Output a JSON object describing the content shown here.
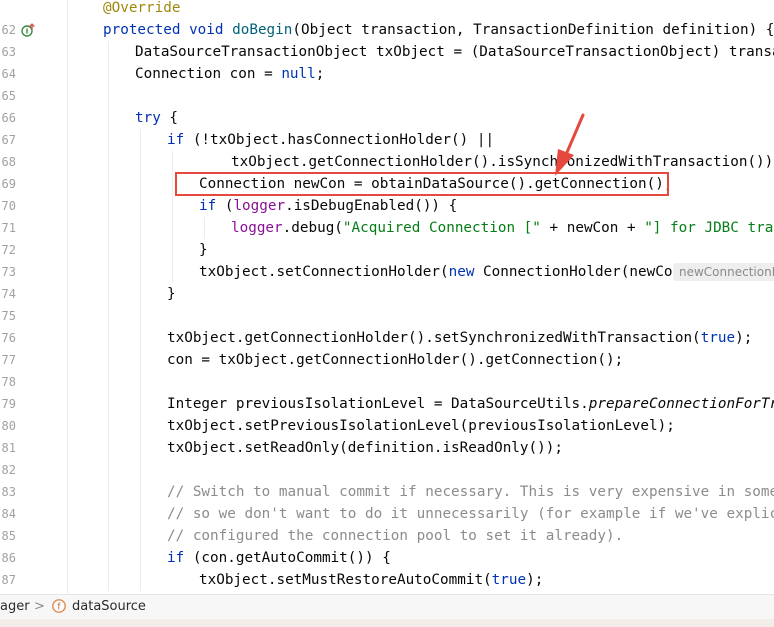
{
  "editor": {
    "lines": [
      {
        "num": "",
        "tokens": [
          {
            "t": "@Override",
            "c": "ann"
          }
        ]
      },
      {
        "num": "62",
        "gutter_icon": "override-implements-icon",
        "tokens": [
          {
            "t": "protected void ",
            "c": "kw"
          },
          {
            "t": "doBegin",
            "c": "fn"
          },
          {
            "t": "(Object transaction, TransactionDefinition definition) {",
            "c": ""
          }
        ]
      },
      {
        "num": "63",
        "tokens": [
          {
            "t": "DataSourceTransactionObject txObject = (DataSourceTransactionObject) transaction",
            "c": ""
          }
        ]
      },
      {
        "num": "64",
        "tokens": [
          {
            "t": "Connection con = ",
            "c": ""
          },
          {
            "t": "null",
            "c": "kw"
          },
          {
            "t": ";",
            "c": ""
          }
        ]
      },
      {
        "num": "65",
        "tokens": []
      },
      {
        "num": "66",
        "tokens": [
          {
            "t": "try",
            "c": "kw"
          },
          {
            "t": " {",
            "c": ""
          }
        ]
      },
      {
        "num": "67",
        "tokens": [
          {
            "t": "if",
            "c": "kw"
          },
          {
            "t": " (!txObject.hasConnectionHolder() ||",
            "c": ""
          }
        ]
      },
      {
        "num": "68",
        "tokens": [
          {
            "t": "txObject.getConnectionHolder().isSynchronizedWithTransaction()) {",
            "c": ""
          }
        ]
      },
      {
        "num": "69",
        "tokens": [
          {
            "t": "Connection newCon = obtainDataSource().getConnection();",
            "c": ""
          }
        ]
      },
      {
        "num": "70",
        "tokens": [
          {
            "t": "if",
            "c": "kw"
          },
          {
            "t": " (",
            "c": ""
          },
          {
            "t": "logger",
            "c": "fld"
          },
          {
            "t": ".isDebugEnabled()) {",
            "c": ""
          }
        ]
      },
      {
        "num": "71",
        "tokens": [
          {
            "t": "logger",
            "c": "fld"
          },
          {
            "t": ".debug(",
            "c": ""
          },
          {
            "t": "\"Acquired Connection [\"",
            "c": "str"
          },
          {
            "t": " + newCon + ",
            "c": ""
          },
          {
            "t": "\"] for JDBC transact",
            "c": "str"
          }
        ]
      },
      {
        "num": "72",
        "tokens": [
          {
            "t": "}",
            "c": ""
          }
        ]
      },
      {
        "num": "73",
        "tokens": [
          {
            "t": "txObject.setConnectionHolder(",
            "c": ""
          },
          {
            "t": "new",
            "c": "kw"
          },
          {
            "t": " ConnectionHolder(newCon),",
            "c": ""
          }
        ],
        "hint": "newConnectionH"
      },
      {
        "num": "74",
        "tokens": [
          {
            "t": "}",
            "c": ""
          }
        ]
      },
      {
        "num": "75",
        "tokens": []
      },
      {
        "num": "76",
        "tokens": [
          {
            "t": "txObject.getConnectionHolder().setSynchronizedWithTransaction(",
            "c": ""
          },
          {
            "t": "true",
            "c": "kw"
          },
          {
            "t": ");",
            "c": ""
          }
        ]
      },
      {
        "num": "77",
        "tokens": [
          {
            "t": "con = txObject.getConnectionHolder().getConnection();",
            "c": ""
          }
        ]
      },
      {
        "num": "78",
        "tokens": []
      },
      {
        "num": "79",
        "tokens": [
          {
            "t": "Integer previousIsolationLevel = DataSourceUtils.",
            "c": ""
          },
          {
            "t": "prepareConnectionForTransac",
            "c": "it"
          }
        ]
      },
      {
        "num": "80",
        "tokens": [
          {
            "t": "txObject.setPreviousIsolationLevel(previousIsolationLevel);",
            "c": ""
          }
        ]
      },
      {
        "num": "81",
        "tokens": [
          {
            "t": "txObject.setReadOnly(definition.isReadOnly());",
            "c": ""
          }
        ]
      },
      {
        "num": "82",
        "tokens": []
      },
      {
        "num": "83",
        "tokens": [
          {
            "t": "// Switch to manual commit if necessary. This is very expensive in some JDBC",
            "c": "cmt"
          }
        ]
      },
      {
        "num": "84",
        "tokens": [
          {
            "t": "// so we don't want to do it unnecessarily (for example if we've explicitly",
            "c": "cmt"
          }
        ]
      },
      {
        "num": "85",
        "tokens": [
          {
            "t": "// configured the connection pool to set it already).",
            "c": "cmt"
          }
        ]
      },
      {
        "num": "86",
        "tokens": [
          {
            "t": "if",
            "c": "kw"
          },
          {
            "t": " (con.getAutoCommit()) {",
            "c": ""
          }
        ]
      },
      {
        "num": "87",
        "tokens": [
          {
            "t": "txObject.setMustRestoreAutoCommit(",
            "c": ""
          },
          {
            "t": "true",
            "c": "kw"
          },
          {
            "t": ");",
            "c": ""
          }
        ]
      }
    ]
  },
  "breadcrumb": {
    "parent": "ager",
    "separator": ">",
    "field_icon": "field-f-icon",
    "field_icon_letter": "f",
    "field": "dataSource"
  },
  "colors": {
    "keyword": "#0033b3",
    "annotation": "#9e880d",
    "method_decl": "#00627a",
    "string": "#067d17",
    "field": "#871094",
    "comment": "#8c8c8c",
    "highlight_box": "#e5483c"
  }
}
